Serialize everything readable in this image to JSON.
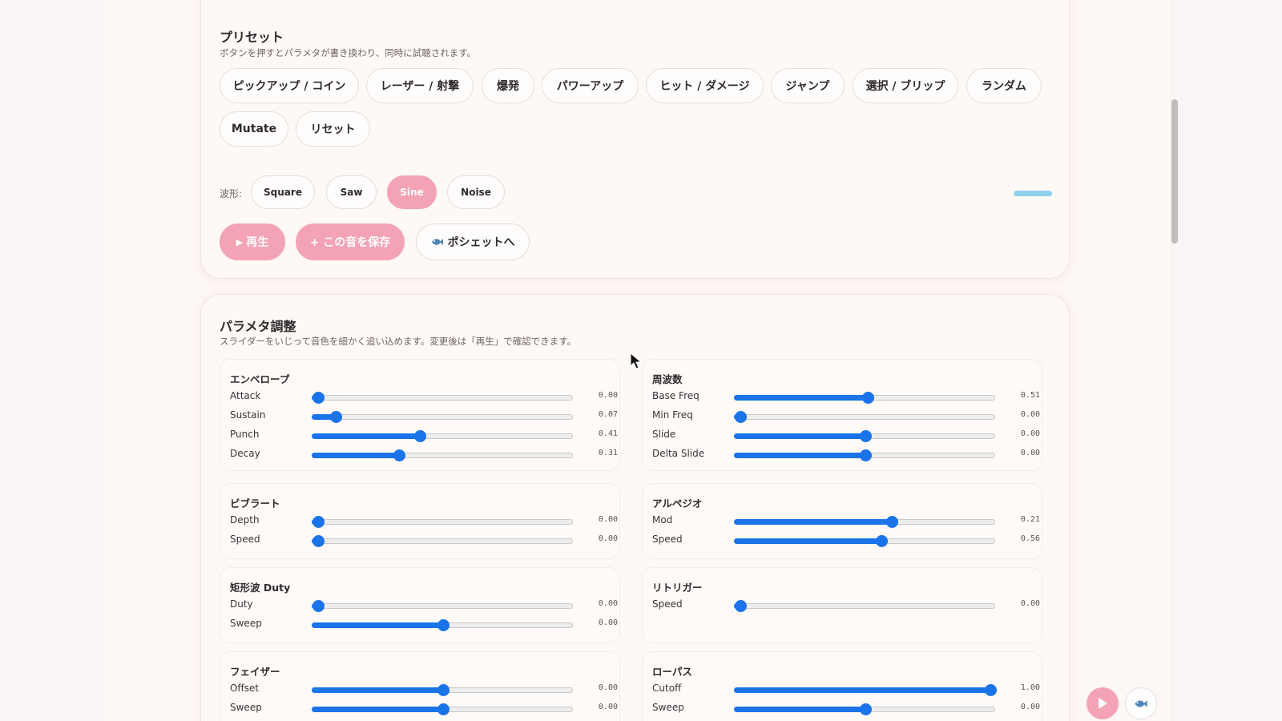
{
  "preset_card": {
    "title": "プリセット",
    "subtitle": "ボタンを押すとパラメタが書き換わり、同時に試聴されます。",
    "presets": [
      "ピックアップ / コイン",
      "レーザー / 射撃",
      "爆発",
      "パワーアップ",
      "ヒット / ダメージ",
      "ジャンプ",
      "選択 / ブリップ",
      "ランダム",
      "Mutate",
      "リセット"
    ],
    "wave_label": "波形:",
    "waves": [
      "Square",
      "Saw",
      "Sine",
      "Noise"
    ],
    "selected_wave": "Sine",
    "play_label": "再生",
    "save_label": "+ この音を保存",
    "pochette_label": "ポシェットへ"
  },
  "param_card": {
    "title": "パラメタ調整",
    "subtitle": "スライダーをいじって音色を細かく追い込めます。変更後は「再生」で確認できます。",
    "groups": [
      {
        "title": "エンベロープ",
        "rows": [
          {
            "label": "Attack",
            "value": "0.00",
            "level": 0.02
          },
          {
            "label": "Sustain",
            "value": "0.07",
            "level": 0.09
          },
          {
            "label": "Punch",
            "value": "0.41",
            "level": 0.41
          },
          {
            "label": "Decay",
            "value": "0.31",
            "level": 0.33
          }
        ]
      },
      {
        "title": "周波数",
        "rows": [
          {
            "label": "Base Freq",
            "value": "0.51",
            "level": 0.51
          },
          {
            "label": "Min Freq",
            "value": "0.00",
            "level": 0.02
          },
          {
            "label": "Slide",
            "value": "0.00",
            "level": 0.5
          },
          {
            "label": "Delta Slide",
            "value": "0.00",
            "level": 0.5
          }
        ]
      },
      {
        "title": "ビブラート",
        "rows": [
          {
            "label": "Depth",
            "value": "0.00",
            "level": 0.02
          },
          {
            "label": "Speed",
            "value": "0.00",
            "level": 0.02
          }
        ]
      },
      {
        "title": "アルペジオ",
        "rows": [
          {
            "label": "Mod",
            "value": "0.21",
            "level": 0.6
          },
          {
            "label": "Speed",
            "value": "0.56",
            "level": 0.56
          }
        ]
      },
      {
        "title": "矩形波 Duty",
        "rows": [
          {
            "label": "Duty",
            "value": "0.00",
            "level": 0.02
          },
          {
            "label": "Sweep",
            "value": "0.00",
            "level": 0.5
          }
        ]
      },
      {
        "title": "リトリガー",
        "rows": [
          {
            "label": "Speed",
            "value": "0.00",
            "level": 0.02
          }
        ]
      },
      {
        "title": "フェイザー",
        "rows": [
          {
            "label": "Offset",
            "value": "0.00",
            "level": 0.5
          },
          {
            "label": "Sweep",
            "value": "0.00",
            "level": 0.5
          }
        ]
      },
      {
        "title": "ローパス",
        "rows": [
          {
            "label": "Cutoff",
            "value": "1.00",
            "level": 0.98
          },
          {
            "label": "Sweep",
            "value": "0.00",
            "level": 0.5
          }
        ]
      }
    ]
  },
  "icons": {
    "play": "play-icon",
    "fish": "fish-icon",
    "cursor": "mouse-cursor-icon"
  },
  "colors": {
    "accent_pink": "#f3a3b4",
    "slider_blue": "#1a73e8",
    "level_cyan": "#8fd1ec"
  }
}
